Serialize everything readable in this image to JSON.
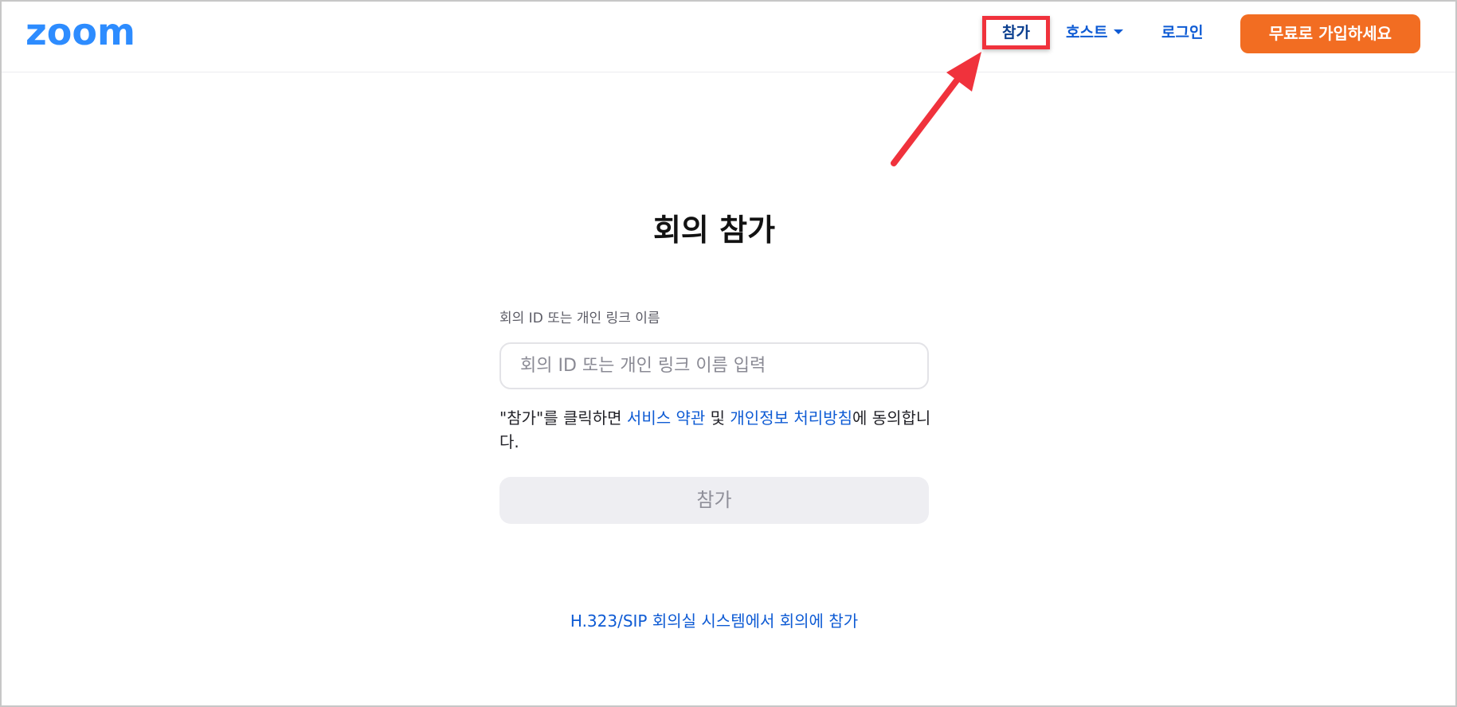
{
  "header": {
    "logo_text": "zoom",
    "nav": {
      "join_label": "참가",
      "host_label": "호스트",
      "login_label": "로그인"
    },
    "signup_label": "무료로 가입하세요"
  },
  "main": {
    "title": "회의 참가",
    "field_label": "회의 ID 또는 개인 링크 이름",
    "input_placeholder": "회의 ID 또는 개인 링크 이름 입력",
    "input_value": "",
    "agreement": {
      "prefix": "\"참가\"를 클릭하면 ",
      "terms_link": "서비스 약관",
      "middle": " 및 ",
      "privacy_link": "개인정보 처리방침",
      "suffix": "에 동의합니다."
    },
    "join_button_label": "참가",
    "sip_link": "H.323/SIP 회의실 시스템에서 회의에 참가"
  },
  "colors": {
    "brand_blue": "#0e5bd4",
    "signup_orange": "#f26d22",
    "annotation_red": "#f0323c",
    "disabled_button_bg": "#eeeef2"
  },
  "icons": {
    "logo": "zoom-logo",
    "host_dropdown": "caret-down-icon",
    "annotation": "red-arrow-annotation"
  }
}
